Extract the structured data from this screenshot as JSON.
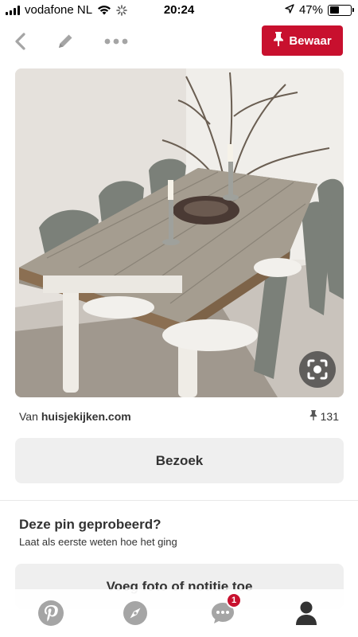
{
  "status_bar": {
    "carrier": "vodafone NL",
    "time": "20:24",
    "battery_percent": "47%",
    "battery_level": 0.47
  },
  "top_nav": {
    "save_label": "Bewaar"
  },
  "pin": {
    "source_prefix": "Van",
    "source_domain": "huisjekijken.com",
    "save_count": "131",
    "visit_label": "Bezoek",
    "tried_title": "Deze pin geprobeerd?",
    "tried_subtitle": "Laat als eerste weten hoe het ging",
    "add_photo_label": "Voeg foto of notitie toe"
  },
  "tab_bar": {
    "notification_count": "1"
  },
  "colors": {
    "brand_red": "#c8102e",
    "button_gray": "#efefef",
    "icon_gray": "#a5a5a5"
  }
}
